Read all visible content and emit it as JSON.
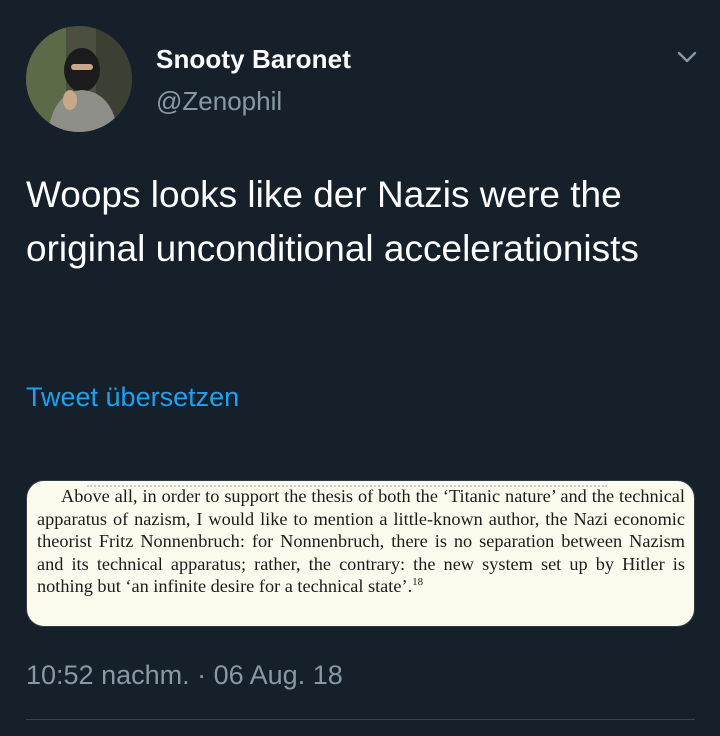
{
  "author": {
    "display_name": "Snooty Baronet",
    "handle": "@Zenophil",
    "avatar_icon": "avatar-photo"
  },
  "menu": {
    "icon": "chevron-down-icon"
  },
  "tweet": {
    "text": "Woops looks like der Nazis were the original unconditional accelerationists",
    "translate_label": "Tweet übersetzen",
    "timestamp": "10:52 nachm. · 06 Aug. 18"
  },
  "media": {
    "quote_text": "Above all, in order to support the thesis of both the ‘Titanic nature’ and the technical apparatus of nazism, I would like to mention a little-known author, the Nazi economic theorist Fritz Nonnenbruch: for Nonnenbruch, there is no separation between Nazism and its technical apparatus; rather, the contrary: the new system set up by Hitler is nothing but ‘an infinite desire for a technical state’.",
    "footnote": "18"
  },
  "colors": {
    "background": "#15202b",
    "primary_text": "#ffffff",
    "secondary_text": "#8899a6",
    "link": "#1da1f2",
    "media_background": "#fbfbee"
  }
}
